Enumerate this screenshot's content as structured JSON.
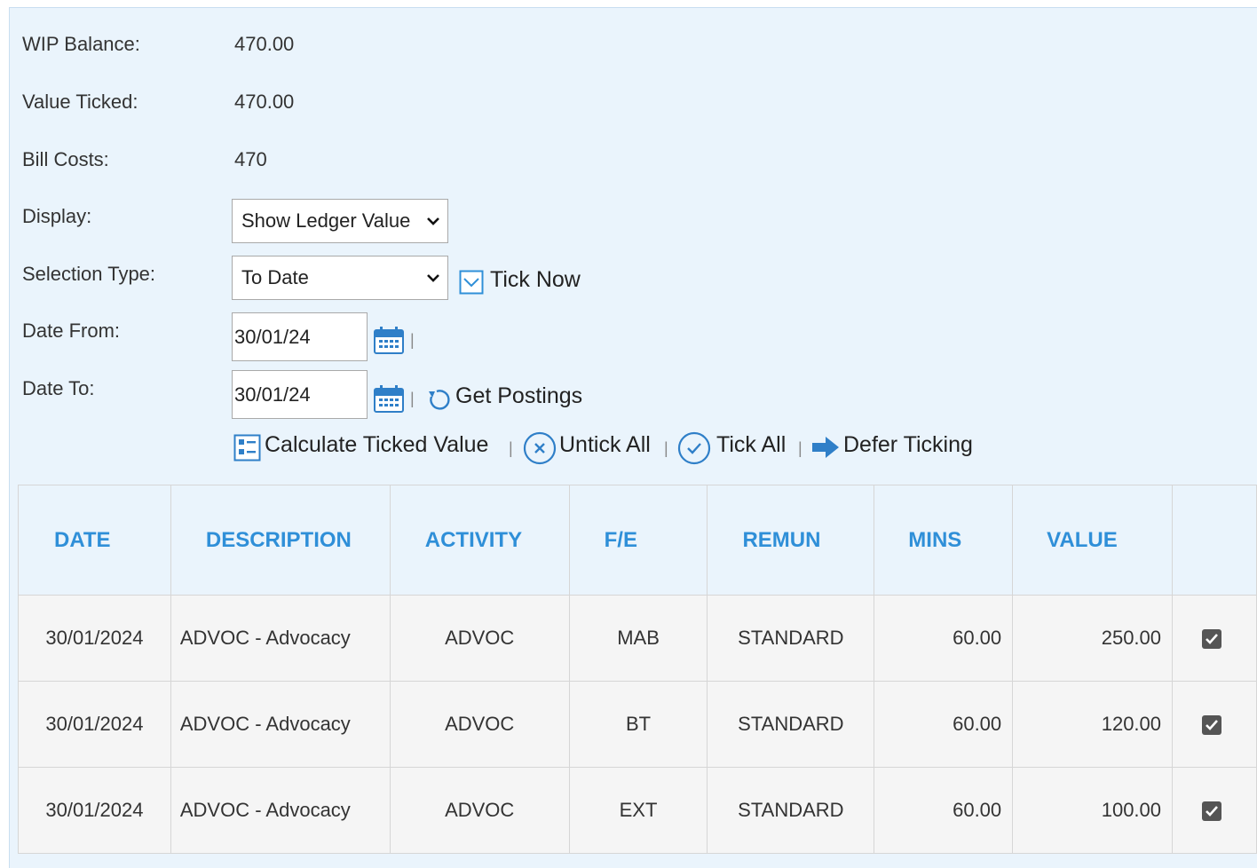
{
  "summary": {
    "wip_balance_label": "WIP Balance:",
    "wip_balance_value": "470.00",
    "value_ticked_label": "Value Ticked:",
    "value_ticked_value": "470.00",
    "bill_costs_label": "Bill Costs:",
    "bill_costs_value": "470"
  },
  "filters": {
    "display_label": "Display:",
    "display_value": "Show Ledger Value",
    "selection_type_label": "Selection Type:",
    "selection_type_value": "To Date",
    "tick_now_label": "Tick Now",
    "date_from_label": "Date From:",
    "date_from_value": "30/01/24",
    "date_to_label": "Date To:",
    "date_to_value": "30/01/24",
    "get_postings_label": "Get Postings"
  },
  "actions": {
    "calculate_label": "Calculate Ticked Value",
    "untick_all_label": "Untick All",
    "tick_all_label": "Tick All",
    "defer_ticking_label": "Defer Ticking"
  },
  "table": {
    "headers": [
      "DATE",
      "DESCRIPTION",
      "ACTIVITY",
      "F/E",
      "REMUN",
      "MINS",
      "VALUE",
      ""
    ],
    "rows": [
      {
        "date": "30/01/2024",
        "description": "ADVOC - Advocacy",
        "activity": "ADVOC",
        "fe": "MAB",
        "remun": "STANDARD",
        "mins": "60.00",
        "value": "250.00",
        "ticked": true
      },
      {
        "date": "30/01/2024",
        "description": "ADVOC - Advocacy",
        "activity": "ADVOC",
        "fe": "BT",
        "remun": "STANDARD",
        "mins": "60.00",
        "value": "120.00",
        "ticked": true
      },
      {
        "date": "30/01/2024",
        "description": "ADVOC - Advocacy",
        "activity": "ADVOC",
        "fe": "EXT",
        "remun": "STANDARD",
        "mins": "60.00",
        "value": "100.00",
        "ticked": true
      }
    ]
  },
  "colors": {
    "panel_bg": "#eaf4fc",
    "accent_blue": "#2f8fd8",
    "row_bg": "#f5f5f5"
  }
}
